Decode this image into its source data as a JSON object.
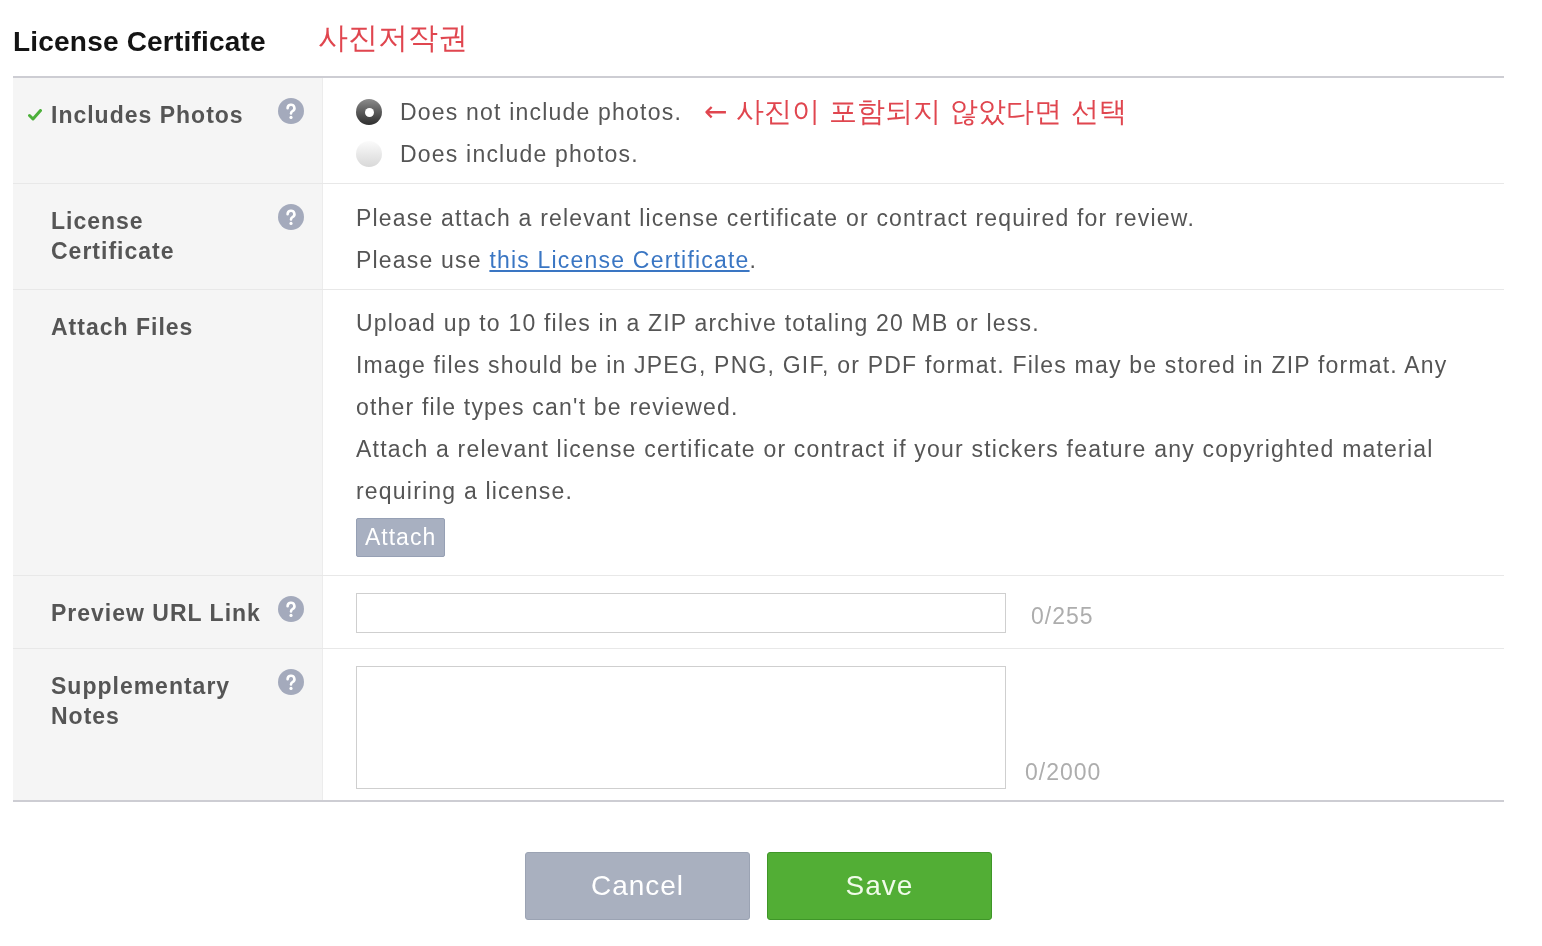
{
  "title": "License Certificate",
  "title_annotation": "사진저작권",
  "rows": [
    {
      "kind": "radio",
      "label": "Includes Photos",
      "complete": true,
      "help": true,
      "options": [
        {
          "label": "Does not include photos.",
          "selected": true,
          "annotation": "← 사진이 포함되지 않았다면 선택"
        },
        {
          "label": "Does include photos.",
          "selected": false
        }
      ]
    },
    {
      "kind": "text",
      "label": "License Certificate",
      "complete": false,
      "help": true,
      "description": "Please attach a relevant license certificate or contract required for review.",
      "link_sentence": {
        "before": "Please use ",
        "link": "this License Certificate",
        "after": "."
      }
    },
    {
      "kind": "upload",
      "label": "Attach Files",
      "complete": false,
      "help": false,
      "paragraphs": [
        "Upload up to 10 files in a ZIP archive totaling 20 MB or less.",
        "Image files should be in JPEG, PNG, GIF, or PDF format. Files may be stored in ZIP format. Any other file types can't be reviewed.",
        "Attach a relevant license certificate or contract if your stickers feature any copyrighted material requiring a license."
      ],
      "button": "Attach"
    },
    {
      "kind": "input",
      "label": "Preview URL Link",
      "complete": false,
      "help": true,
      "counter": "0/255"
    },
    {
      "kind": "textarea",
      "label": "Supplementary Notes",
      "complete": false,
      "help": true,
      "counter": "0/2000"
    }
  ],
  "buttons": [
    {
      "kind": "cancel",
      "label": "Cancel"
    },
    {
      "kind": "save",
      "label": "Save"
    }
  ]
}
